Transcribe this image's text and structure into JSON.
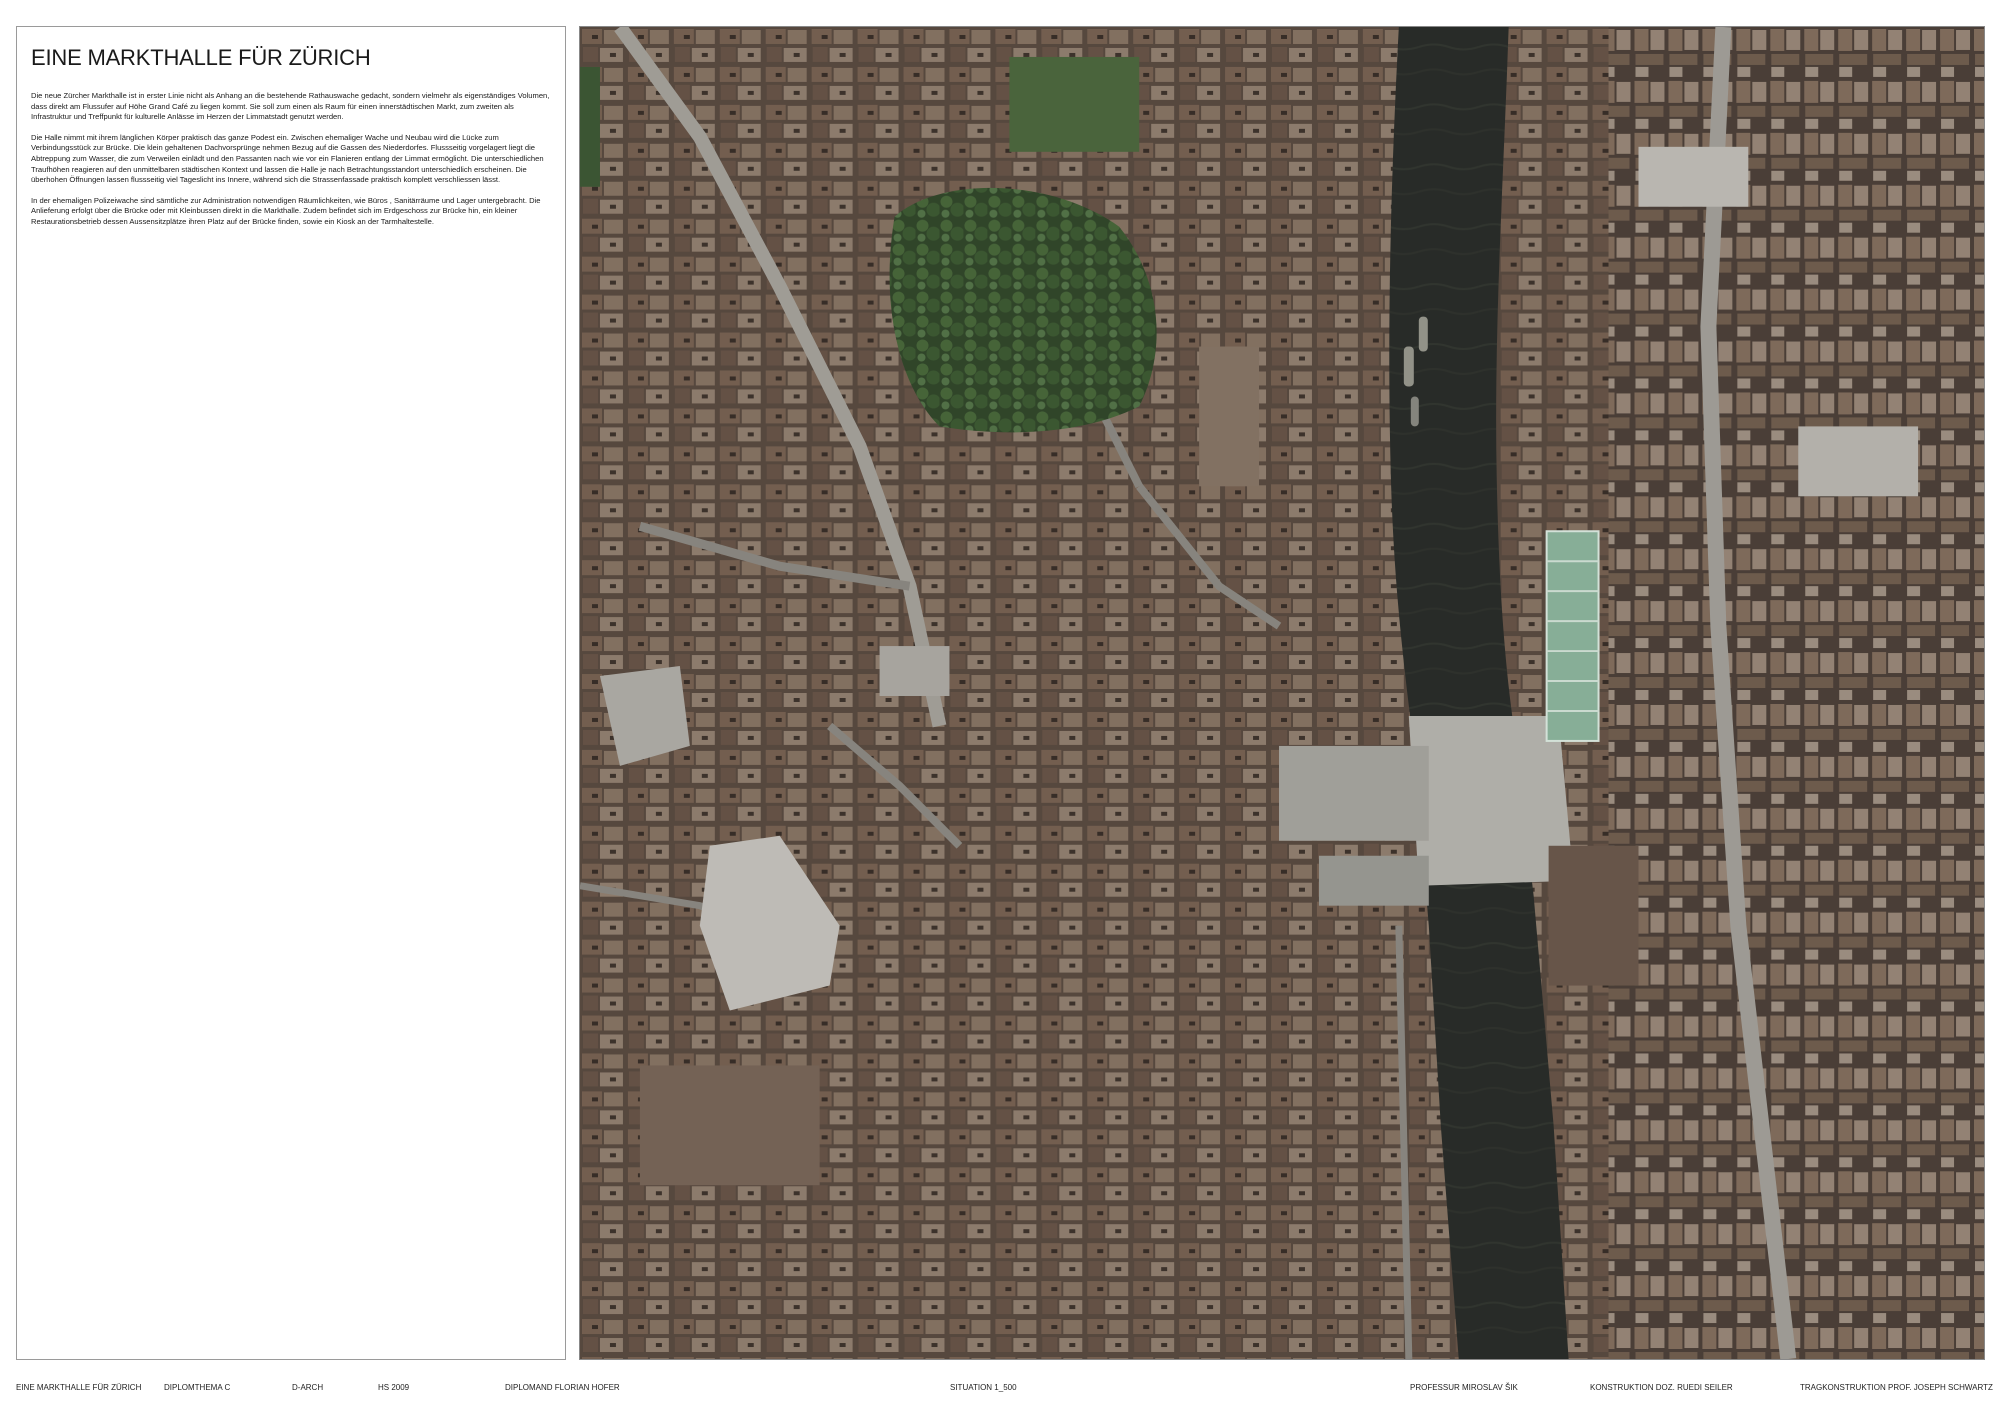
{
  "panel": {
    "title": "EINE MARKTHALLE FÜR ZÜRICH",
    "paragraphs": [
      "Die neue Zürcher Markthalle ist in erster Linie nicht als Anhang an die bestehende Rathauswache gedacht, sondern vielmehr als eigenständiges Volumen, dass direkt am Flussufer auf Höhe Grand Café zu liegen kommt. Sie soll zum einen als Raum für einen innerstädtischen Markt, zum zweiten als Infrastruktur und Treffpunkt für kulturelle Anlässe im Herzen der Limmatstadt genutzt werden.",
      "Die Halle nimmt mit ihrem länglichen Körper praktisch das ganze Podest ein. Zwischen ehemaliger Wache und Neubau wird die Lücke zum Verbindungsstück zur Brücke. Die klein gehaltenen Dachvorsprünge nehmen Bezug auf die Gassen des Niederdorfes. Flussseitig vorgelagert liegt die Abtreppung zum Wasser, die zum Verweilen einlädt und den Passanten nach wie vor ein Flanieren entlang der Limmat ermöglicht. Die unterschiedlichen Traufhöhen reagieren auf den unmittelbaren städtischen Kontext und lassen die Halle je nach Betrachtungsstandort unterschiedlich erscheinen. Die überhohen Öffnungen lassen flussseitig viel Tageslicht ins Innere, während sich die Strassenfassade praktisch komplett verschliessen lässt.",
      "In der ehemaligen Polizeiwache sind sämtliche zur Administration notwendigen Räumlichkeiten, wie Büros , Sanitärräume und Lager untergebracht. Die Anlieferung erfolgt über die Brücke oder mit Kleinbussen direkt in die Markthalle. Zudem befindet sich im Erdgeschoss zur Brücke hin, ein kleiner Restaurationsbetrieb dessen Aussensitzplätze ihren Platz auf der Brücke finden, sowie ein Kiosk an der Tarmhaltestelle."
    ]
  },
  "footer": {
    "project": "EINE MARKTHALLE FÜR ZÜRICH",
    "thema": "DIPLOMTHEMA C",
    "department": "D-ARCH",
    "semester": "HS 2009",
    "diplomand": "DIPLOMAND  FLORIAN HOFER",
    "sheet": "SITUATION 1_500",
    "professor": "PROFESSUR MIROSLAV ŠIK",
    "konstruktion": "KONSTRUKTION DOZ. RUEDI SEILER",
    "tragkonstruktion": "TRAGKONSTRUKTION  PROF. JOSEPH SCHWARTZ"
  },
  "colors": {
    "river": "#2b2e2b",
    "roof": "#6e5a4c",
    "park": "#3f5a36",
    "plaza": "#b4b3ad",
    "glass_roof": "#8fb8a0",
    "street": "#9d9a93"
  }
}
